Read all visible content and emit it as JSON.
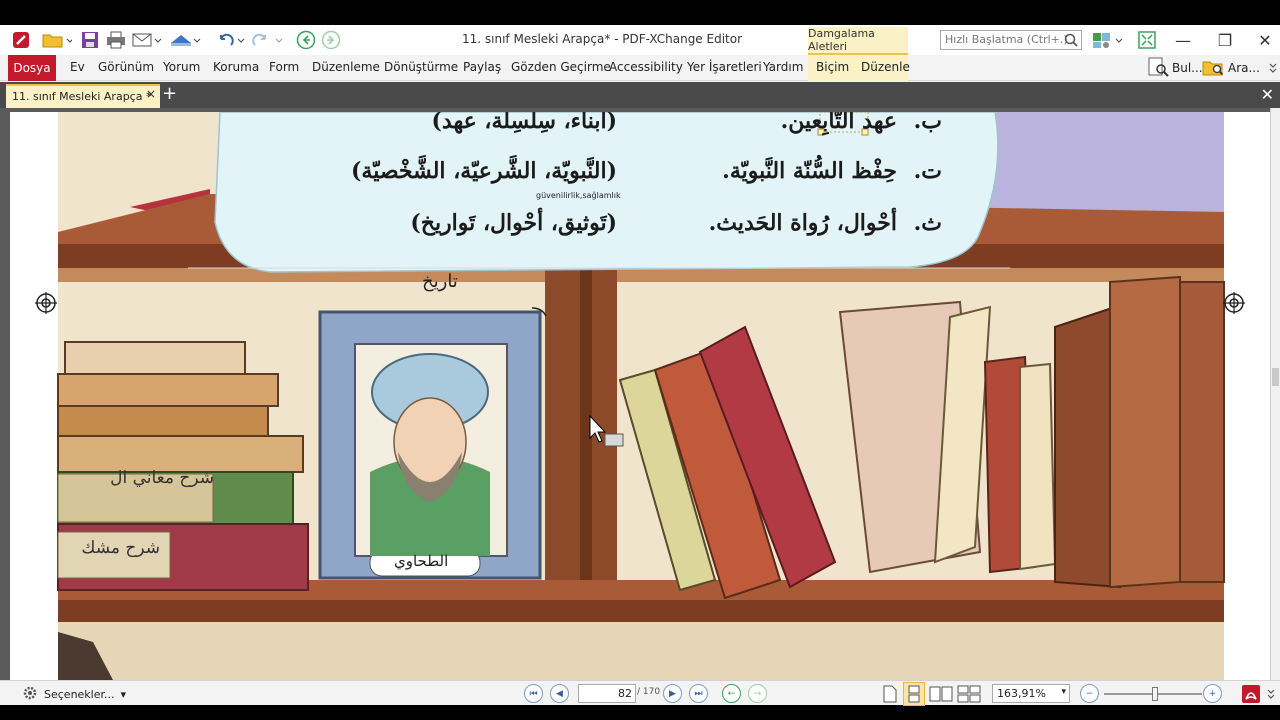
{
  "window": {
    "title": "11. sınıf Mesleki Arapça* - PDF-XChange Editor",
    "context_tab": "Damgalama Aletleri",
    "quick_launch_placeholder": "Hızlı Başlatma (Ctrl+.)",
    "minimize": "—",
    "restore": "❐",
    "close": "✕"
  },
  "menu": {
    "file": "Dosya",
    "items": [
      "Ev",
      "Görünüm",
      "Yorum",
      "Koruma",
      "Form",
      "Düzenleme",
      "Dönüştürme",
      "Paylaş",
      "Gözden Geçirme",
      "Accessibility",
      "Yer İşaretleri",
      "Yardım",
      "Biçim",
      "Düzenle"
    ],
    "find": "Bul...",
    "search": "Ara..."
  },
  "tabs": {
    "doc_tab": "11. sınıf Mesleki Arapça *",
    "close": "×",
    "new": "+",
    "close_all": "✕"
  },
  "document": {
    "rows": [
      {
        "letter": "ب.",
        "phrase": "عهد التّابِعين.",
        "options": "(ابناء، سِلسِلة، عهد)"
      },
      {
        "letter": "ت.",
        "phrase": "حِفْظ السُّنّة النَّبويّة.",
        "options": "(النَّبويّة، الشَّرعيّة، الشَّخْصيّة)"
      },
      {
        "letter": "ث.",
        "phrase": "أحْوال، رُواة الحَديث.",
        "options": "(تَوثيق، أحْوال، تَواريخ)"
      }
    ],
    "annotation_small": "güvenilirlik,sağlamlık",
    "annotation_handwritten": "تاريخ",
    "book_label_1": "شرح معاني ال",
    "book_label_2": "شرح مشك",
    "portrait_label": "الطحاوي"
  },
  "status": {
    "options": "Seçenekler...",
    "current_page": "82",
    "total_pages": "/ 170",
    "zoom": "163,91%"
  },
  "colors": {
    "accent_red": "#c21a2a",
    "context_yellow": "#fbf1c7",
    "tab_dark": "#4a4a4a",
    "speech_bubble": "#e3f4f8",
    "shelf_wood": "#a85b36"
  }
}
